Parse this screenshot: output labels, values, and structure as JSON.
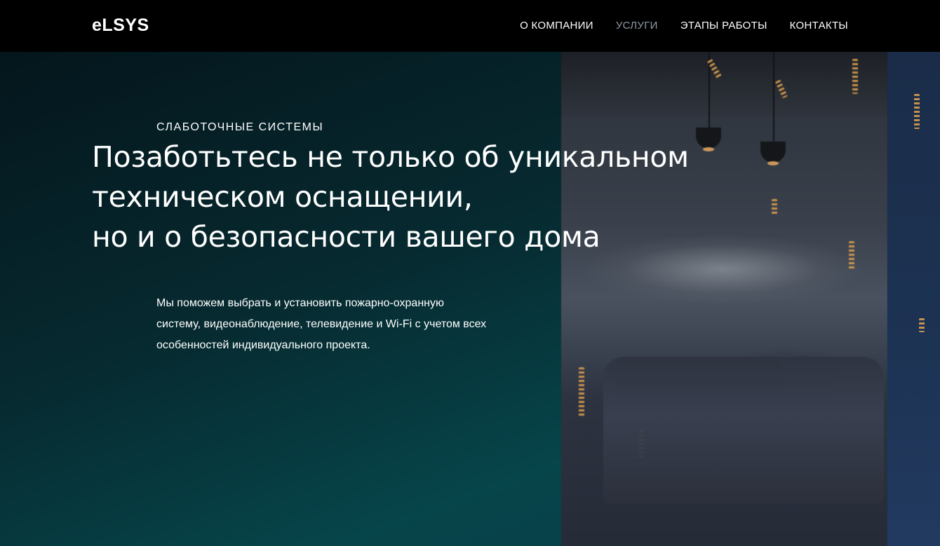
{
  "header": {
    "logo": "eLSYS",
    "nav": [
      {
        "label": "О КОМПАНИИ",
        "active": false
      },
      {
        "label": "УСЛУГИ",
        "active": true
      },
      {
        "label": "ЭТАПЫ РАБОТЫ",
        "active": false
      },
      {
        "label": "КОНТАКТЫ",
        "active": false
      }
    ]
  },
  "hero": {
    "eyebrow": "СЛАБОТОЧНЫЕ СИСТЕМЫ",
    "headline_lines": [
      "Позаботьтесь не только об уникальном",
      "техническом оснащении,",
      "но и о безопасности вашего дома"
    ],
    "description_lines": [
      "Мы поможем выбрать и установить пожарно-охранную",
      "систему, видеонаблюдение, телевидение и Wi-Fi с учетом всех",
      "особенностей индивидуального проекта."
    ]
  },
  "colors": {
    "header_bg": "#000000",
    "nav_active": "#8f9aa4",
    "text": "#ffffff"
  }
}
